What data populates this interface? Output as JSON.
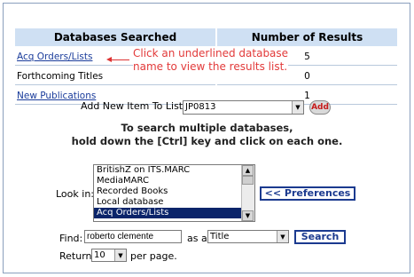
{
  "results": {
    "headers": [
      "Databases Searched",
      "Number of Results"
    ],
    "rows": [
      {
        "name": "Acq Orders/Lists",
        "count": "5",
        "link": true
      },
      {
        "name": "Forthcoming Titles",
        "count": "0",
        "link": false
      },
      {
        "name": "New Publications",
        "count": "1",
        "link": true
      }
    ]
  },
  "callout": {
    "line1": "Click an underlined database",
    "line2": "name to view the results list."
  },
  "add_item": {
    "label": "Add New Item To List:",
    "selected": "JP0813",
    "button": "Add"
  },
  "instructions": {
    "line1": "To search multiple databases,",
    "line2": "hold down the [Ctrl] key and click on each one."
  },
  "lookin": {
    "label": "Look in:",
    "options": [
      "BritishZ on ITS.MARC",
      "MediaMARC",
      "Recorded Books",
      "Local database",
      "Acq Orders/Lists"
    ],
    "selected_index": 4
  },
  "preferences_button": "<< Preferences",
  "find": {
    "label": "Find:",
    "value": "roberto clemente",
    "as_a": "as a",
    "field": "Title",
    "search_button": "Search"
  },
  "return": {
    "label": "Return",
    "value": "10",
    "suffix": "per page."
  },
  "colors": {
    "header_bg": "#cfe0f3",
    "link": "#1a3c9b",
    "callout": "#e23a3a",
    "selected_bg": "#0a246a"
  }
}
